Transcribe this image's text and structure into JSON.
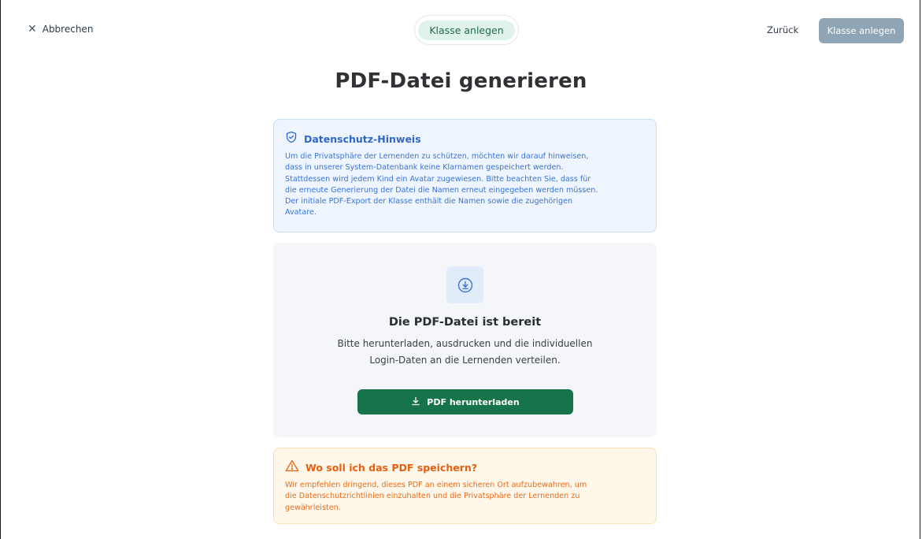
{
  "topbar": {
    "cancel_label": "Abbrechen",
    "step_label": "Klasse anlegen",
    "back_label": "Zurück",
    "primary_label": "Klasse anlegen"
  },
  "page": {
    "title": "PDF-Datei generieren"
  },
  "privacy_notice": {
    "title": "Datenschutz-Hinweis",
    "lines": [
      "Um die Privatsphäre der Lernenden zu schützen, möchten wir darauf hinweisen,",
      "dass in unserer System-Datenbank keine Klarnamen gespeichert werden.",
      "Stattdessen wird jedem Kind ein Avatar zugewiesen. Bitte beachten Sie, dass für",
      "die erneute Generierung der Datei die Namen erneut eingegeben werden müssen.",
      "Der initiale PDF-Export der Klasse enthält die Namen sowie die zugehörigen",
      "Avatare."
    ],
    "color": "#3b73d6"
  },
  "ready_card": {
    "title": "Die PDF-Datei ist bereit",
    "desc_line1": "Bitte herunterladen, ausdrucken und die individuellen",
    "desc_line2": "Login-Daten an die Lernenden verteilen.",
    "download_label": "PDF herunterladen",
    "button_color": "#17734a"
  },
  "warning": {
    "title": "Wo soll ich das PDF speichern?",
    "lines": [
      "Wir empfehlen dringend, dieses PDF an einem sicheren Ort aufzubewahren, um",
      "die Datenschutzrichtlinien einzuhalten und die Privatsphäre der Lernenden zu",
      "gewährleisten."
    ],
    "color": "#e8600f"
  },
  "icons": {
    "close": "close-icon",
    "shield": "shield-check-icon",
    "download_circle": "download-circle-icon",
    "download": "download-icon",
    "warning": "warning-triangle-icon"
  }
}
